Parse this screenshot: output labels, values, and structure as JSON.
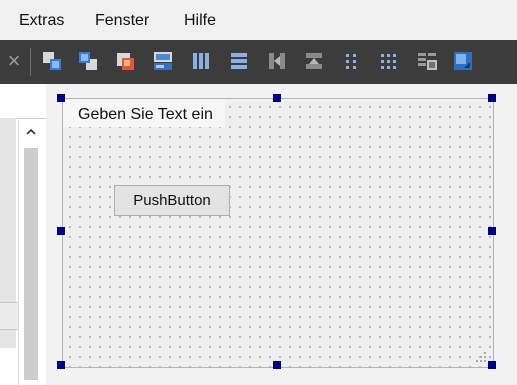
{
  "menubar": {
    "items": [
      "Extras",
      "Fenster",
      "Hilfe"
    ]
  },
  "toolbar": {
    "close_glyph": "×",
    "buttons": [
      "send-to-back-icon",
      "bring-to-front-icon",
      "edit-tab-order-icon",
      "edit-buddies-icon",
      "lay-out-horizontally-icon",
      "lay-out-vertically-icon",
      "lay-out-horizontally-splitter-icon",
      "lay-out-vertically-splitter-icon",
      "lay-out-form-layout-icon",
      "lay-out-grid-icon",
      "break-layout-icon",
      "adjust-size-icon"
    ]
  },
  "form": {
    "title": "Geben Sie Text ein",
    "push_button_label": "PushButton"
  },
  "colors": {
    "menubar_bg": "#f0f0f0",
    "toolbar_bg": "#3c3c3c",
    "selection_handle": "#000080",
    "form_bg": "#efefef"
  }
}
